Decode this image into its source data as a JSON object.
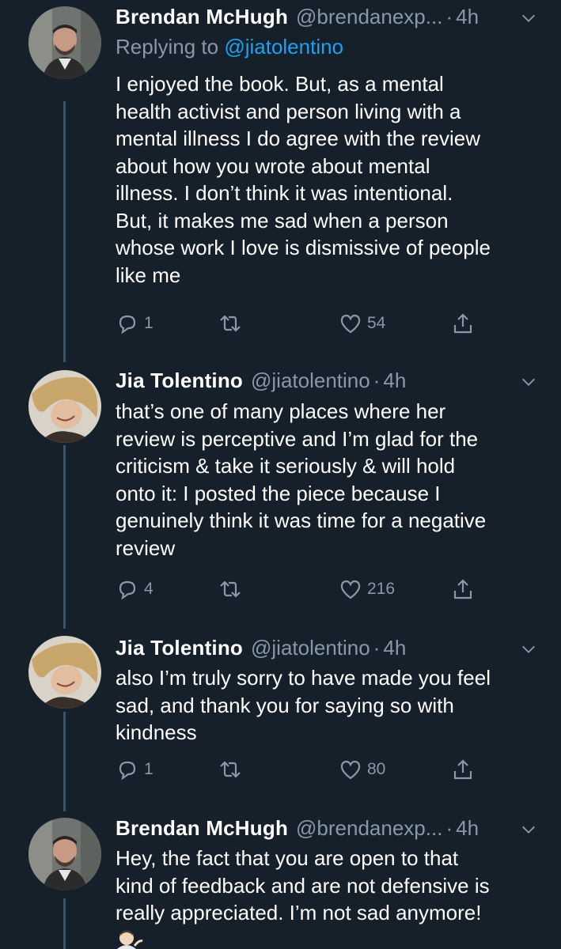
{
  "tweets": [
    {
      "name": "Brendan McHugh",
      "handle": "@brendanexp...",
      "dot": "·",
      "time": "4h",
      "replying_to_prefix": "Replying to",
      "replying_to_handle": "@jiatolentino",
      "text": "I enjoyed the book. But, as a mental\nhealth activist and person living with a\nmental illness I do agree with the review\nabout how you wrote about mental\nillness. I don’t think it was intentional.\nBut, it makes me sad when a person\nwhose work I love is dismissive of people\nlike me",
      "replies": "1",
      "likes": "54"
    },
    {
      "name": "Jia Tolentino",
      "handle": "@jiatolentino",
      "dot": "·",
      "time": "4h",
      "text": "that’s one of many places where her\nreview is perceptive and I’m glad for the\ncriticism & take it seriously & will hold\nonto it: I posted the piece because I\ngenuinely think it was time for a negative\nreview",
      "replies": "4",
      "likes": "216"
    },
    {
      "name": "Jia Tolentino",
      "handle": "@jiatolentino",
      "dot": "·",
      "time": "4h",
      "text": "also I’m truly sorry to have made you feel\nsad, and thank you for saying so with\nkindness",
      "replies": "1",
      "likes": "80"
    },
    {
      "name": "Brendan McHugh",
      "handle": "@brendanexp...",
      "dot": "·",
      "time": "4h",
      "text": "Hey, the fact that you are open to that\nkind of feedback and are not defensive is\nreally appreciated. I’m not sad anymore!",
      "emoji": "person-tipping-hand-icon"
    }
  ],
  "colors": {
    "background": "#15202b",
    "text": "#ffffff",
    "secondary": "#8899a6",
    "link": "#1da1f2",
    "thread_line": "#3d5466"
  },
  "icons": [
    "reply-icon",
    "retweet-icon",
    "like-icon",
    "share-icon",
    "chevron-down-icon"
  ]
}
